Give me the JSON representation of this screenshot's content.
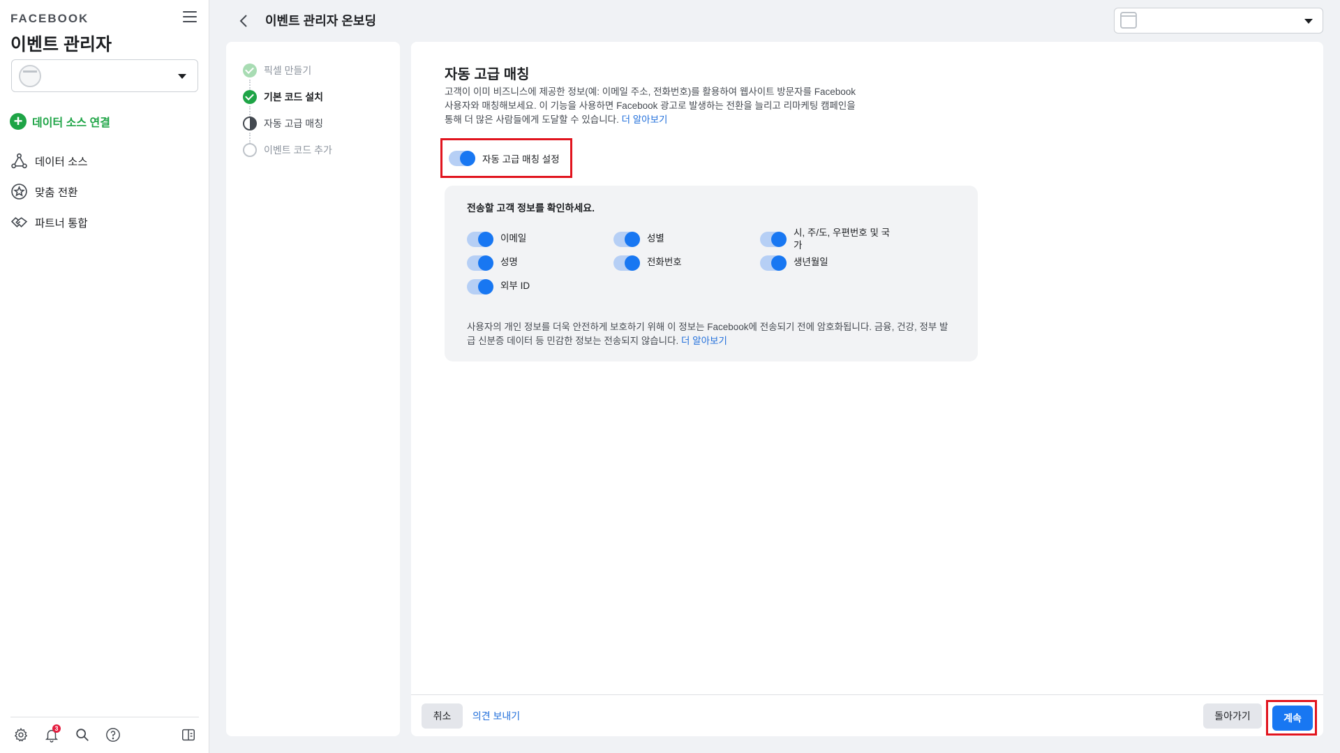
{
  "sidebar": {
    "brand": "FACEBOOK",
    "app_title": "이벤트 관리자",
    "connect_label": "데이터 소스 연결",
    "nav": [
      {
        "label": "데이터 소스",
        "icon": "data-sources-icon"
      },
      {
        "label": "맞춤 전환",
        "icon": "custom-conversions-icon"
      },
      {
        "label": "파트너 통합",
        "icon": "partner-integrations-icon"
      }
    ],
    "notification_count": "3"
  },
  "header": {
    "title": "이벤트 관리자 온보딩"
  },
  "steps": [
    {
      "label": "픽셀 만들기",
      "state": "done-faded"
    },
    {
      "label": "기본 코드 설치",
      "state": "done"
    },
    {
      "label": "자동 고급 매칭",
      "state": "current"
    },
    {
      "label": "이벤트 코드 추가",
      "state": "todo"
    }
  ],
  "main": {
    "title": "자동 고급 매칭",
    "description": "고객이 이미 비즈니스에 제공한 정보(예: 이메일 주소, 전화번호)를 활용하여 웹사이트 방문자를 Facebook 사용자와 매칭해보세요. 이 기능을 사용하면 Facebook 광고로 발생하는 전환을 늘리고 리마케팅 캠페인을 통해 더 많은 사람들에게 도달할 수 있습니다.",
    "learn_more": "더 알아보기",
    "master_toggle_label": "자동 고급 매칭 설정",
    "master_toggle_on": true,
    "info_title": "전송할 고객 정보를 확인하세요.",
    "fields": [
      {
        "label": "이메일",
        "on": true
      },
      {
        "label": "성별",
        "on": true
      },
      {
        "label": "시, 주/도, 우편번호 및 국가",
        "on": true
      },
      {
        "label": "성명",
        "on": true
      },
      {
        "label": "전화번호",
        "on": true
      },
      {
        "label": "생년월일",
        "on": true
      },
      {
        "label": "외부 ID",
        "on": true
      }
    ],
    "note": "사용자의 개인 정보를 더욱 안전하게 보호하기 위해 이 정보는 Facebook에 전송되기 전에 암호화됩니다. 금융, 건강, 정부 발급 신분증 데이터 등 민감한 정보는 전송되지 않습니다.",
    "note_learn_more": "더 알아보기"
  },
  "footer": {
    "cancel": "취소",
    "feedback": "의견 보내기",
    "back": "돌아가기",
    "continue": "계속"
  },
  "colors": {
    "accent": "#1877f2",
    "success": "#1ea446",
    "highlight": "#e1141e"
  }
}
